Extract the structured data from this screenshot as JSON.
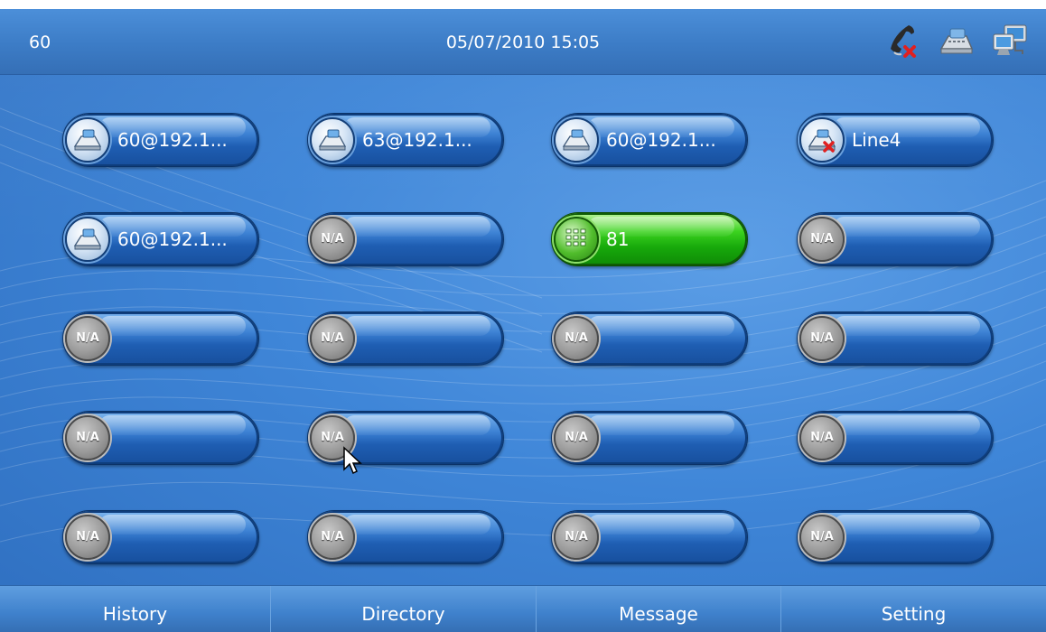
{
  "header": {
    "extension": "60",
    "datetime": "05/07/2010 15:05",
    "status_icons": [
      "handset-off-icon",
      "desk-phone-icon",
      "network-computer-icon"
    ]
  },
  "lines": [
    {
      "label": "60@192.1...",
      "icon": "desk-phone-icon",
      "state": "registered"
    },
    {
      "label": "63@192.1...",
      "icon": "desk-phone-icon",
      "state": "registered"
    },
    {
      "label": "60@192.1...",
      "icon": "desk-phone-icon",
      "state": "registered"
    },
    {
      "label": "Line4",
      "icon": "desk-phone-error-icon",
      "state": "failed"
    },
    {
      "label": "60@192.1...",
      "icon": "desk-phone-icon",
      "state": "registered"
    },
    {
      "label": "",
      "icon": "na-icon",
      "na_text": "N/A",
      "state": "unassigned"
    },
    {
      "label": "81",
      "icon": "keypad-icon",
      "state": "active"
    },
    {
      "label": "",
      "icon": "na-icon",
      "na_text": "N/A",
      "state": "unassigned"
    },
    {
      "label": "",
      "icon": "na-icon",
      "na_text": "N/A",
      "state": "unassigned"
    },
    {
      "label": "",
      "icon": "na-icon",
      "na_text": "N/A",
      "state": "unassigned"
    },
    {
      "label": "",
      "icon": "na-icon",
      "na_text": "N/A",
      "state": "unassigned"
    },
    {
      "label": "",
      "icon": "na-icon",
      "na_text": "N/A",
      "state": "unassigned"
    },
    {
      "label": "",
      "icon": "na-icon",
      "na_text": "N/A",
      "state": "unassigned"
    },
    {
      "label": "",
      "icon": "na-icon",
      "na_text": "N/A",
      "state": "unassigned"
    },
    {
      "label": "",
      "icon": "na-icon",
      "na_text": "N/A",
      "state": "unassigned"
    },
    {
      "label": "",
      "icon": "na-icon",
      "na_text": "N/A",
      "state": "unassigned"
    },
    {
      "label": "",
      "icon": "na-icon",
      "na_text": "N/A",
      "state": "unassigned"
    },
    {
      "label": "",
      "icon": "na-icon",
      "na_text": "N/A",
      "state": "unassigned"
    },
    {
      "label": "",
      "icon": "na-icon",
      "na_text": "N/A",
      "state": "unassigned"
    },
    {
      "label": "",
      "icon": "na-icon",
      "na_text": "N/A",
      "state": "unassigned"
    }
  ],
  "footer": {
    "tabs": [
      {
        "label": "History"
      },
      {
        "label": "Directory"
      },
      {
        "label": "Message"
      },
      {
        "label": "Setting"
      }
    ]
  },
  "colors": {
    "background": "#3f86d8",
    "pill_blue": "#1f5eb3",
    "pill_active_green": "#17a90b",
    "error_red": "#e02020"
  }
}
